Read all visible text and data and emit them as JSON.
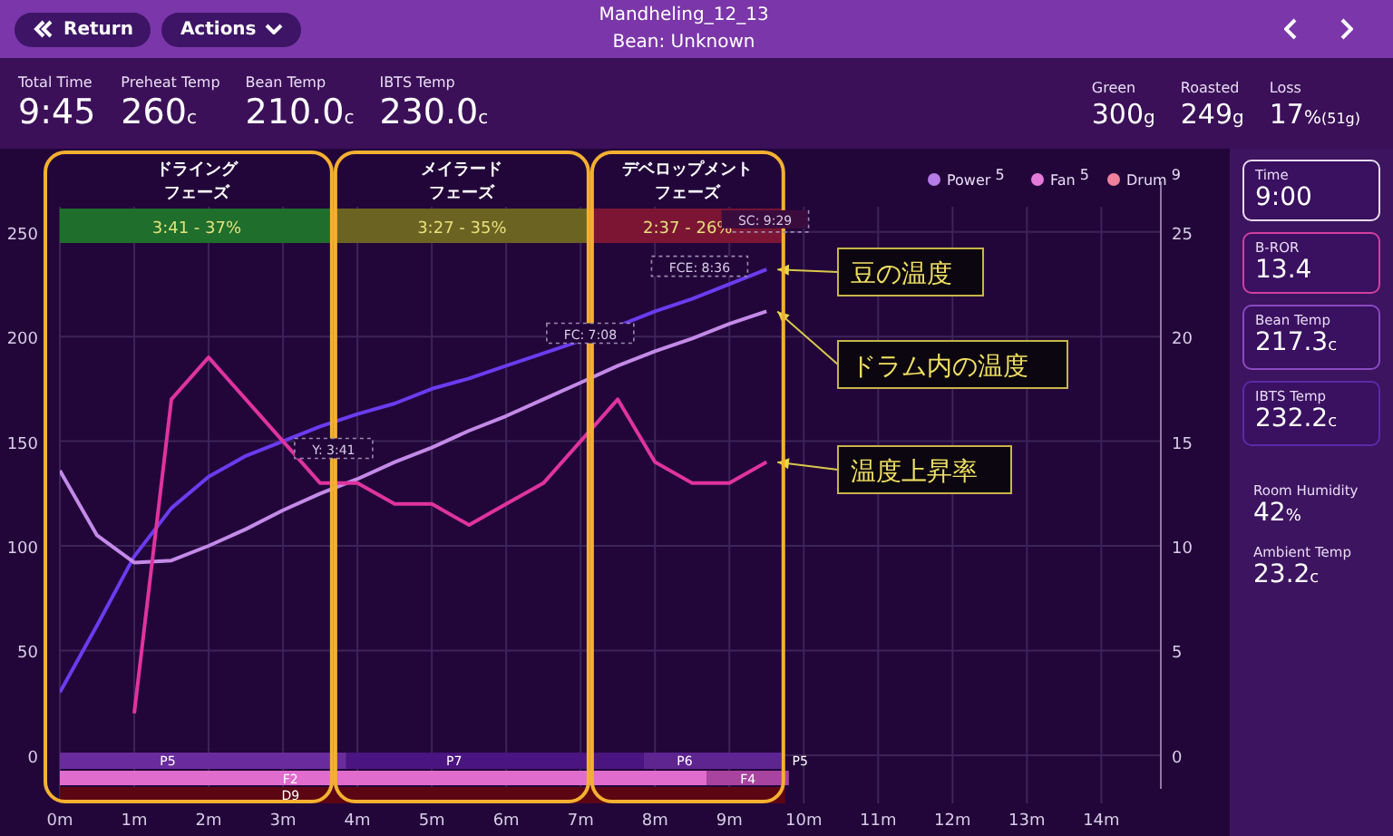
{
  "header": {
    "back_button": "Return",
    "actions_button": "Actions",
    "title": "Mandheling_12_13",
    "subtitle": "Bean: Unknown"
  },
  "stats_left": [
    {
      "label": "Total Time",
      "value": "9:45"
    },
    {
      "label": "Preheat Temp",
      "value": "260",
      "unit": "c"
    },
    {
      "label": "Bean Temp",
      "value": "210.0",
      "unit": "c"
    },
    {
      "label": "IBTS Temp",
      "value": "230.0",
      "unit": "c"
    }
  ],
  "stats_right": [
    {
      "label": "Green",
      "value": "300",
      "unit": "g"
    },
    {
      "label": "Roasted",
      "value": "249",
      "unit": "g"
    },
    {
      "label": "Loss",
      "value": "17",
      "unit": "%",
      "note": "(51g)"
    }
  ],
  "chart": {
    "legend": [
      {
        "label": "Power",
        "value": "5",
        "color": "#b57be6"
      },
      {
        "label": "Fan",
        "value": "5",
        "color": "#e57bd8"
      },
      {
        "label": "Drum",
        "value": "9",
        "color": "#f0809c"
      }
    ],
    "phases": [
      {
        "title_lines": [
          "ドライング",
          "フェーズ"
        ],
        "bar": "3:41 - 37%",
        "color": "#1f6e2c"
      },
      {
        "title_lines": [
          "メイラード",
          "フェーズ"
        ],
        "bar": "3:27 - 35%",
        "color": "#6b6322"
      },
      {
        "title_lines": [
          "デベロップメント",
          "フェーズ"
        ],
        "bar": "2:37 - 26%",
        "color": "#7c1533"
      }
    ],
    "markers": [
      {
        "label": "Y: 3:41",
        "kind": "box"
      },
      {
        "label": "FC: 7:08",
        "kind": "box"
      },
      {
        "label": "FCE: 8:36",
        "kind": "box"
      },
      {
        "label": "SC: 9:29",
        "kind": "flag"
      }
    ],
    "controls": [
      {
        "kind": "power",
        "segments": [
          {
            "label": "P5",
            "color": "#6a2c9c"
          },
          {
            "label": "P7",
            "color": "#4a1580"
          },
          {
            "label": "P6",
            "color": "#5e2590"
          },
          {
            "label": "P5"
          }
        ]
      },
      {
        "kind": "fan",
        "segments": [
          {
            "label": "F2",
            "color": "#e06ccd"
          },
          {
            "label": "F4",
            "color": "#a8439f"
          }
        ]
      },
      {
        "kind": "drum",
        "segments": [
          {
            "label": "D9",
            "color": "#5c0614"
          }
        ]
      }
    ],
    "chart_data": {
      "type": "line",
      "grid": true,
      "x": [
        0,
        0.5,
        1,
        1.5,
        2,
        2.5,
        3,
        3.5,
        4,
        4.5,
        5,
        5.5,
        6,
        6.5,
        7,
        7.5,
        8,
        8.5,
        9,
        9.5
      ],
      "xlim": [
        0,
        14.8
      ],
      "ylim": [
        -23,
        262
      ],
      "y2lim": [
        -2.3,
        26.2
      ],
      "xticks": [
        {
          "value": 0,
          "label": "0m"
        },
        {
          "value": 1,
          "label": "1m"
        },
        {
          "value": 2,
          "label": "2m"
        },
        {
          "value": 3,
          "label": "3m"
        },
        {
          "value": 4,
          "label": "4m"
        },
        {
          "value": 5,
          "label": "5m"
        },
        {
          "value": 6,
          "label": "6m"
        },
        {
          "value": 7,
          "label": "7m"
        },
        {
          "value": 8,
          "label": "8m"
        },
        {
          "value": 9,
          "label": "9m"
        },
        {
          "value": 10,
          "label": "10m"
        },
        {
          "value": 11,
          "label": "11m"
        },
        {
          "value": 12,
          "label": "12m"
        },
        {
          "value": 13,
          "label": "13m"
        },
        {
          "value": 14,
          "label": "14m"
        }
      ],
      "yticks": [
        0,
        50,
        100,
        150,
        200,
        250
      ],
      "y2ticks": [
        0,
        5,
        10,
        15,
        20,
        25
      ],
      "series": [
        {
          "name": "豆の温度",
          "color": "#6a3cf0",
          "values": [
            30,
            62,
            95,
            118,
            133,
            143,
            150,
            157,
            163,
            168,
            175,
            180,
            186,
            192,
            198,
            205,
            212,
            218,
            225,
            232
          ]
        },
        {
          "name": "ドラム内の温度",
          "color": "#c48ae8",
          "values": [
            136,
            105,
            92,
            93,
            100,
            108,
            117,
            125,
            132,
            140,
            147,
            155,
            162,
            170,
            178,
            186,
            193,
            199,
            206,
            212
          ]
        },
        {
          "name": "温度上昇率",
          "color": "#e0339f",
          "axis": "y2",
          "values": [
            null,
            null,
            2,
            17,
            19,
            17,
            15,
            13,
            13,
            12,
            12,
            11,
            12,
            13,
            15,
            17,
            14,
            13,
            13,
            14
          ]
        }
      ]
    }
  },
  "readouts": [
    {
      "label": "Time",
      "value": "9:00",
      "color": "#e8dcf4"
    },
    {
      "label": "B-ROR",
      "value": "13.4",
      "color": "#d23fa0"
    },
    {
      "label": "Bean Temp",
      "value": "217.3",
      "unit": "c",
      "color": "#8a4ac0"
    },
    {
      "label": "IBTS Temp",
      "value": "232.2",
      "unit": "c",
      "color": "#5b2aa8"
    }
  ],
  "ambient": [
    {
      "label": "Room Humidity",
      "value": "42",
      "unit": "%"
    },
    {
      "label": "Ambient Temp",
      "value": "23.2",
      "unit": "c"
    }
  ]
}
